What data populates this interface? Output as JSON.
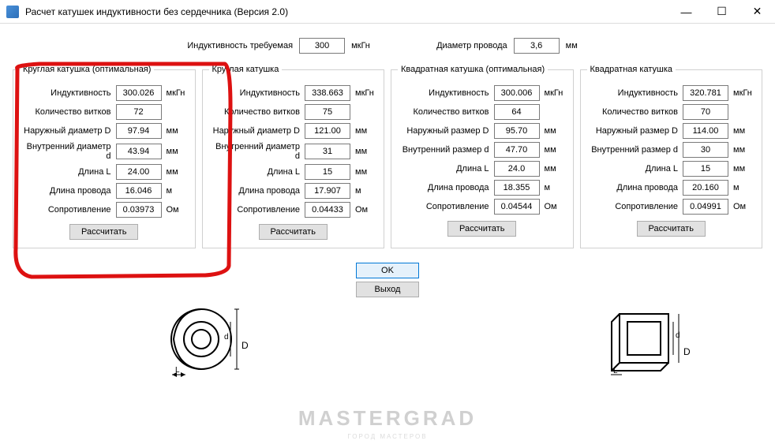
{
  "window": {
    "title": "Расчет катушек индуктивности без сердечника (Версия 2.0)"
  },
  "top": {
    "inductance_label": "Индуктивность требуемая",
    "inductance_value": "300",
    "inductance_unit": "мкГн",
    "wire_label": "Диаметр провода",
    "wire_value": "3,6",
    "wire_unit": "мм"
  },
  "units": {
    "mkgn": "мкГн",
    "mm": "мм",
    "m": "м",
    "ohm": "Ом"
  },
  "labels": {
    "inductance": "Индуктивность",
    "turns": "Количество витков",
    "outer_diam": "Наружный диаметр D",
    "inner_diam": "Внутренний диаметр d",
    "outer_size": "Наружный размер D",
    "inner_size": "Внутренний размер d",
    "length": "Длина L",
    "wire_len": "Длина провода",
    "resistance": "Сопротивление",
    "calculate": "Рассчитать",
    "ok": "OK",
    "exit": "Выход"
  },
  "panels": [
    {
      "title": "Круглая катушка (оптимальная)",
      "type": "round",
      "inductance": "300.026",
      "turns": "72",
      "outer": "97.94",
      "inner": "43.94",
      "length": "24.00",
      "wire_len": "16.046",
      "resistance": "0.03973"
    },
    {
      "title": "Круглая катушка",
      "type": "round",
      "inductance": "338.663",
      "turns": "75",
      "outer": "121.00",
      "inner": "31",
      "length": "15",
      "wire_len": "17.907",
      "resistance": "0.04433"
    },
    {
      "title": "Квадратная катушка (оптимальная)",
      "type": "square",
      "inductance": "300.006",
      "turns": "64",
      "outer": "95.70",
      "inner": "47.70",
      "length": "24.0",
      "wire_len": "18.355",
      "resistance": "0.04544"
    },
    {
      "title": "Квадратная катушка",
      "type": "square",
      "inductance": "320.781",
      "turns": "70",
      "outer": "114.00",
      "inner": "30",
      "length": "15",
      "wire_len": "20.160",
      "resistance": "0.04991"
    }
  ],
  "watermark": "MASTERGRAD",
  "watermark_sub": "ГОРОД МАСТЕРОВ"
}
